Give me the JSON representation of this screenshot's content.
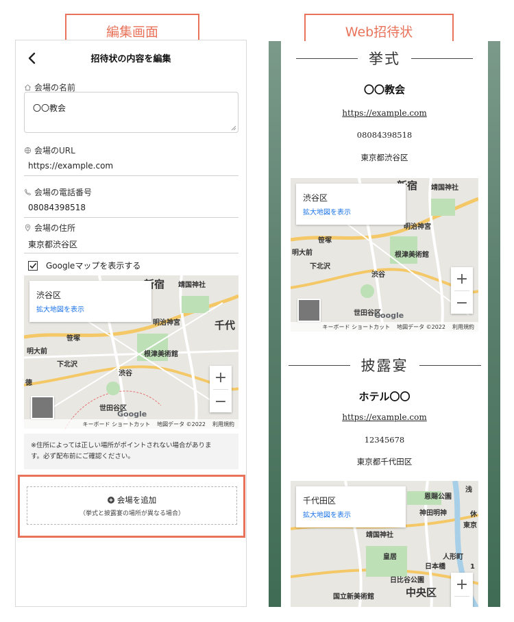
{
  "callouts": {
    "left": "編集画面",
    "right": "Web招待状"
  },
  "editor": {
    "title": "招待状の内容を編集",
    "venue_name_label": "会場の名前",
    "venue_name_value": "〇〇教会",
    "venue_url_label": "会場のURL",
    "venue_url_value": "https://example.com",
    "venue_phone_label": "会場の電話番号",
    "venue_phone_value": "08084398518",
    "venue_address_label": "会場の住所",
    "venue_address_value": "東京都渋谷区",
    "show_map_label": "Googleマップを表示する",
    "show_map_checked": true,
    "notice_line1": "※住所によっては正しい場所がポイントされない場合がありま",
    "notice_line2": "す。必ず配布前にご確認ください。",
    "add_venue_label": "会場を追加",
    "add_venue_sub": "（挙式と披露宴の場所が異なる場合）"
  },
  "map_common": {
    "enlarge_link": "拡大地図を表示",
    "footer_keyboard": "キーボード ショートカット",
    "footer_data": "地図データ ©2022",
    "footer_terms": "利用規約",
    "google": "Google"
  },
  "map_shibuya": {
    "place": "渋谷区",
    "labels": [
      "新宿",
      "靖国神社",
      "千代",
      "明治神宮",
      "笹塚",
      "根津美術館",
      "明大前",
      "下北沢",
      "渋谷",
      "世田谷区",
      "徳"
    ]
  },
  "map_chiyoda": {
    "place": "千代田区",
    "labels": [
      "恩賜公園",
      "浅",
      "東京",
      "神田明神",
      "靖国神社",
      "皇居",
      "人形町",
      "日本橋",
      "日比谷公園",
      "中央区",
      "国立新美術館",
      "1",
      "休"
    ]
  },
  "invite": {
    "ceremony": {
      "title": "挙式",
      "venue": "〇〇教会",
      "url": "https://example.com",
      "phone": "08084398518",
      "address": "東京都渋谷区"
    },
    "reception": {
      "title": "披露宴",
      "venue": "ホテル〇〇",
      "url": "https://example.com",
      "phone": "12345678",
      "address": "東京都千代田区"
    }
  },
  "colors": {
    "accent": "#e8735a",
    "link": "#1a73e8",
    "green_bg": "#5e8270"
  }
}
